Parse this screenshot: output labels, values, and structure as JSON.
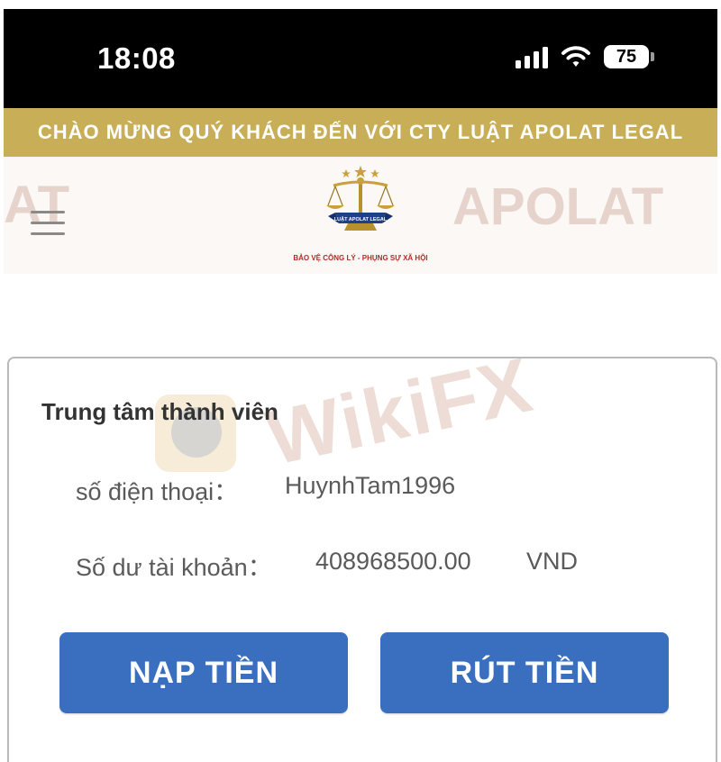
{
  "status_bar": {
    "time": "18:08",
    "battery": "75",
    "icons": [
      "signal-icon",
      "wifi-icon",
      "battery-icon"
    ]
  },
  "banner": {
    "text": "CHÀO MỪNG QUÝ KHÁCH ĐẾN VỚI CTY LUẬT APOLAT LEGAL"
  },
  "header": {
    "logo_badge": "LUẬT APOLAT LEGAL",
    "logo_tagline": "BẢO VỆ CÔNG LÝ - PHỤNG SỰ XÃ HỘI",
    "watermark_right": "APOLAT",
    "watermark_left": "AT",
    "menu_icon": "hamburger-menu-icon"
  },
  "member_center": {
    "title": "Trung tâm thành viên",
    "phone_label": "số điện thoại：",
    "phone_value": "HuynhTam1996",
    "balance_label": "Số dư tài khoản：",
    "balance_value": "408968500.00",
    "currency": "VND",
    "deposit_label": "NẠP TIỀN",
    "withdraw_label": "RÚT TIỀN"
  },
  "watermark": {
    "text": "WikiFX"
  },
  "colors": {
    "banner": "#c8ae57",
    "button": "#3a6fc0",
    "status_bar": "#000000",
    "tagline": "#b52a25"
  }
}
